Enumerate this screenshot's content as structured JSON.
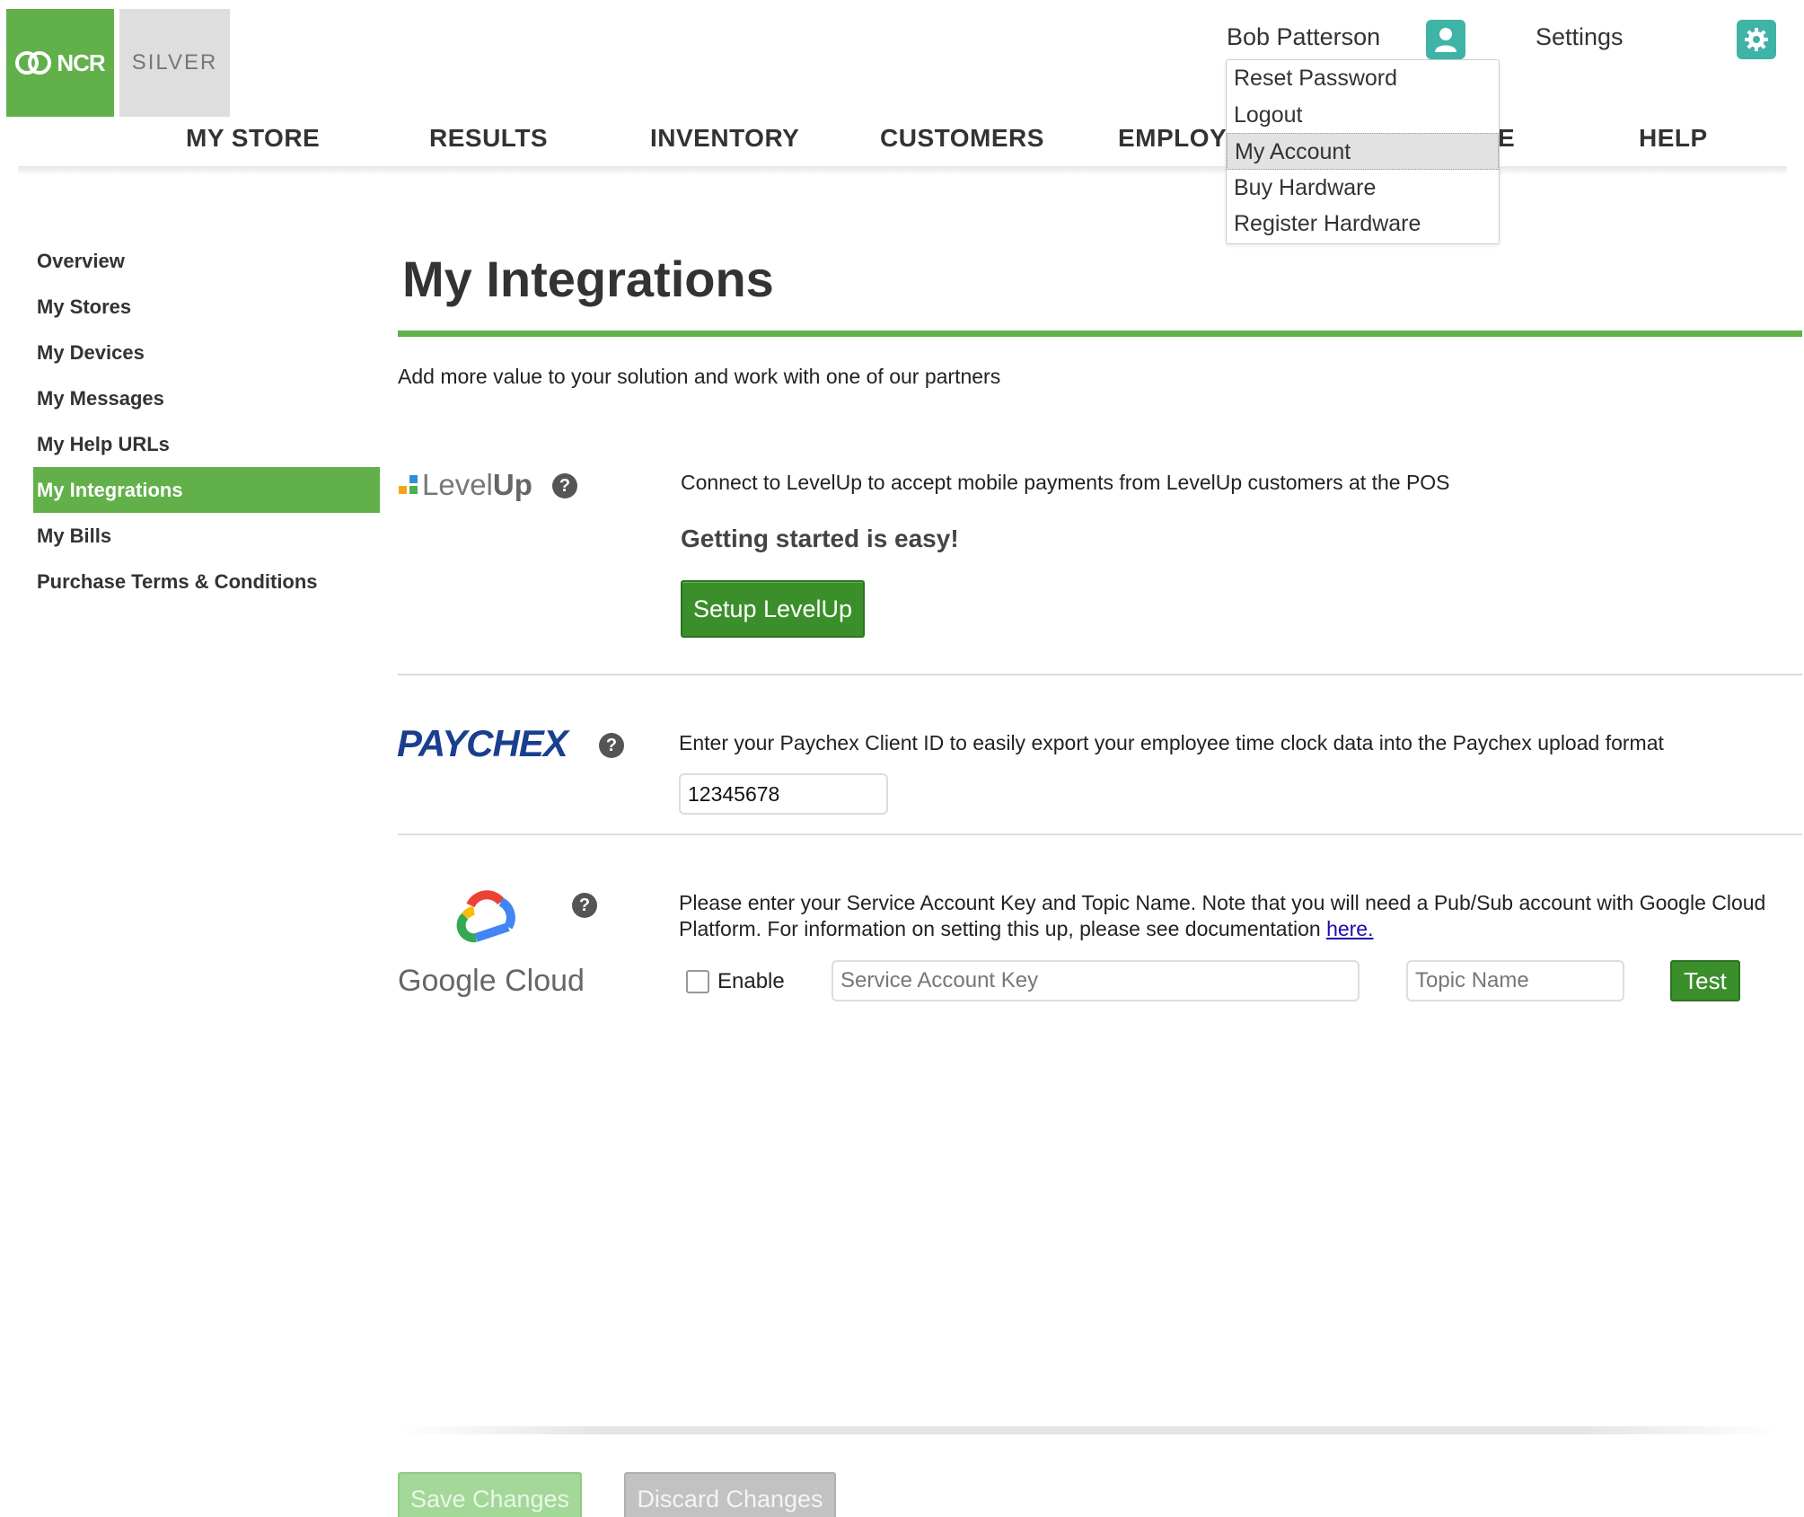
{
  "header": {
    "logo_ncr": "NCR",
    "logo_silver": "SILVER",
    "user_name": "Bob Patterson",
    "settings_label": "Settings",
    "icons": {
      "user": "user-icon",
      "settings": "gear-icon"
    },
    "accent_color": "#62b04a",
    "icon_bg_color": "#3fb3a6"
  },
  "nav": {
    "items": [
      "MY STORE",
      "RESULTS",
      "INVENTORY",
      "CUSTOMERS",
      "EMPLOY",
      "E",
      "HELP"
    ]
  },
  "user_menu": {
    "items": [
      "Reset Password",
      "Logout",
      "My Account",
      "Buy Hardware",
      "Register Hardware"
    ],
    "highlighted": "My Account"
  },
  "sidebar": {
    "items": [
      "Overview",
      "My Stores",
      "My Devices",
      "My Messages",
      "My Help URLs",
      "My Integrations",
      "My Bills",
      "Purchase Terms & Conditions"
    ],
    "active": "My Integrations"
  },
  "main": {
    "title": "My Integrations",
    "subtitle": "Add more value to your solution and work with one of our partners"
  },
  "levelup": {
    "logo_light": "Level",
    "logo_bold": "Up",
    "description": "Connect to LevelUp to accept mobile payments from LevelUp customers at the POS",
    "easy_text": "Getting started is easy!",
    "button_label": "Setup LevelUp"
  },
  "paychex": {
    "logo": "PAYCHEX",
    "description": "Enter your Paychex Client ID to easily export your employee time clock data into the Paychex upload format",
    "client_id": "12345678"
  },
  "google_cloud": {
    "logo": "Google Cloud",
    "description": "Please enter your Service Account Key and Topic Name. Note that you will need a Pub/Sub account with Google Cloud Platform. For information on setting this up, please see documentation",
    "link_text": "here.",
    "enable_label": "Enable",
    "enable_checked": false,
    "service_key_placeholder": "Service Account Key",
    "topic_placeholder": "Topic Name",
    "test_label": "Test"
  },
  "footer": {
    "save_label": "Save Changes",
    "discard_label": "Discard Changes"
  },
  "help_icon_glyph": "?"
}
